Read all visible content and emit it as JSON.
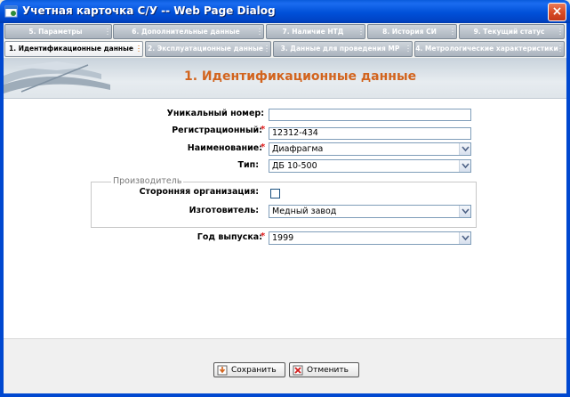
{
  "window": {
    "title": "Учетная карточка С/У -- Web Page Dialog",
    "close_glyph": "×"
  },
  "tabs_row1": [
    {
      "label": "5. Параметры"
    },
    {
      "label": "6. Дополнительные данные"
    },
    {
      "label": "7. Наличие НТД"
    },
    {
      "label": "8. История СИ"
    },
    {
      "label": "9. Текущий статус"
    }
  ],
  "tabs_row2": [
    {
      "label": "1. Идентификационные данные",
      "active": true
    },
    {
      "label": "2. Эксплуатационные данные"
    },
    {
      "label": "3. Данные для проведения МР"
    },
    {
      "label": "4. Метрологические характеристики"
    }
  ],
  "header": {
    "section_title": "1. Идентификационные данные"
  },
  "form": {
    "unique_number_label": "Уникальный номер:",
    "unique_number_value": "",
    "reg_label": "Регистрационный:",
    "reg_value": "12312-434",
    "name_label": "Наименование:",
    "name_value": "Диафрагма",
    "type_label": "Тип:",
    "type_value": "ДБ 10-500",
    "manufacturer_group": "Производитель",
    "third_party_label": "Сторонняя организация:",
    "third_party_checked": false,
    "maker_label": "Изготовитель:",
    "maker_value": "Медный завод",
    "year_label": "Год выпуска:",
    "year_value": "1999",
    "required_mark": "*"
  },
  "footer": {
    "save_label": "Сохранить",
    "cancel_label": "Отменить"
  },
  "colors": {
    "title_bar": "#0050d8",
    "section_title": "#d2641e",
    "required": "#e21a1a",
    "active_tab_grip": "#e07a1f"
  }
}
